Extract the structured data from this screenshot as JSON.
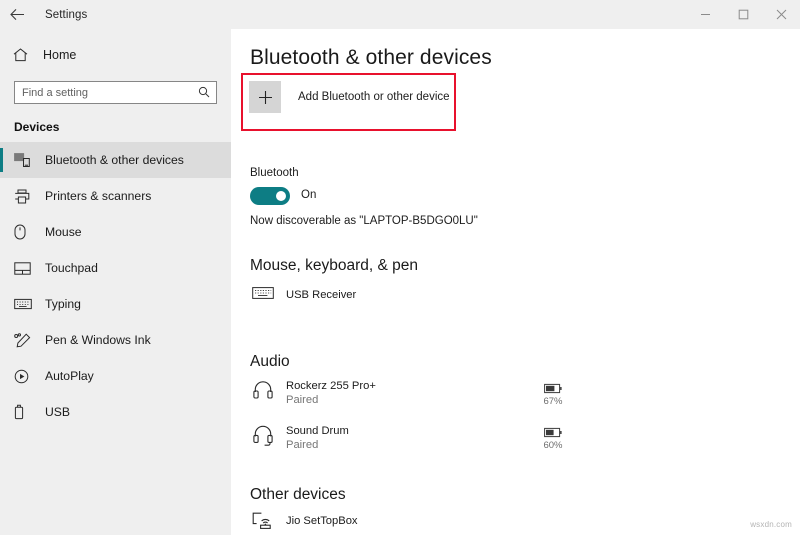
{
  "window": {
    "app_title": "Settings",
    "back_icon": "back-arrow-icon",
    "minimize_label": "Minimize",
    "maximize_label": "Maximize",
    "close_label": "Close"
  },
  "sidebar": {
    "home_label": "Home",
    "home_icon": "home-icon",
    "search": {
      "placeholder": "Find a setting",
      "value": "",
      "icon": "search-icon"
    },
    "section_label": "Devices",
    "items": [
      {
        "label": "Bluetooth & other devices",
        "icon": "bluetooth-devices-icon",
        "selected": true
      },
      {
        "label": "Printers & scanners",
        "icon": "printer-icon",
        "selected": false
      },
      {
        "label": "Mouse",
        "icon": "mouse-icon",
        "selected": false
      },
      {
        "label": "Touchpad",
        "icon": "touchpad-icon",
        "selected": false
      },
      {
        "label": "Typing",
        "icon": "keyboard-icon",
        "selected": false
      },
      {
        "label": "Pen & Windows Ink",
        "icon": "pen-icon",
        "selected": false
      },
      {
        "label": "AutoPlay",
        "icon": "autoplay-icon",
        "selected": false
      },
      {
        "label": "USB",
        "icon": "usb-icon",
        "selected": false
      }
    ]
  },
  "main": {
    "page_title": "Bluetooth & other devices",
    "add_device": {
      "label": "Add Bluetooth or other device",
      "icon": "plus-icon",
      "highlighted": true,
      "highlight_color": "#e8112d"
    },
    "bluetooth": {
      "label": "Bluetooth",
      "state": "On",
      "toggle_on": true,
      "toggle_color": "#0d7d84",
      "discoverable_text": "Now discoverable as \"LAPTOP-B5DGO0LU\""
    },
    "groups": [
      {
        "title": "Mouse, keyboard, & pen",
        "devices": [
          {
            "name": "USB Receiver",
            "status": "",
            "icon": "keyboard-device-icon",
            "battery": null
          }
        ]
      },
      {
        "title": "Audio",
        "devices": [
          {
            "name": "Rockerz 255 Pro+",
            "status": "Paired",
            "icon": "headphones-icon",
            "battery": "67%"
          },
          {
            "name": "Sound Drum",
            "status": "Paired",
            "icon": "headset-icon",
            "battery": "60%"
          }
        ]
      },
      {
        "title": "Other devices",
        "devices": [
          {
            "name": "Jio SetTopBox",
            "status": "",
            "icon": "settopbox-icon",
            "battery": null
          }
        ]
      }
    ]
  },
  "watermark": "wsxdn.com"
}
